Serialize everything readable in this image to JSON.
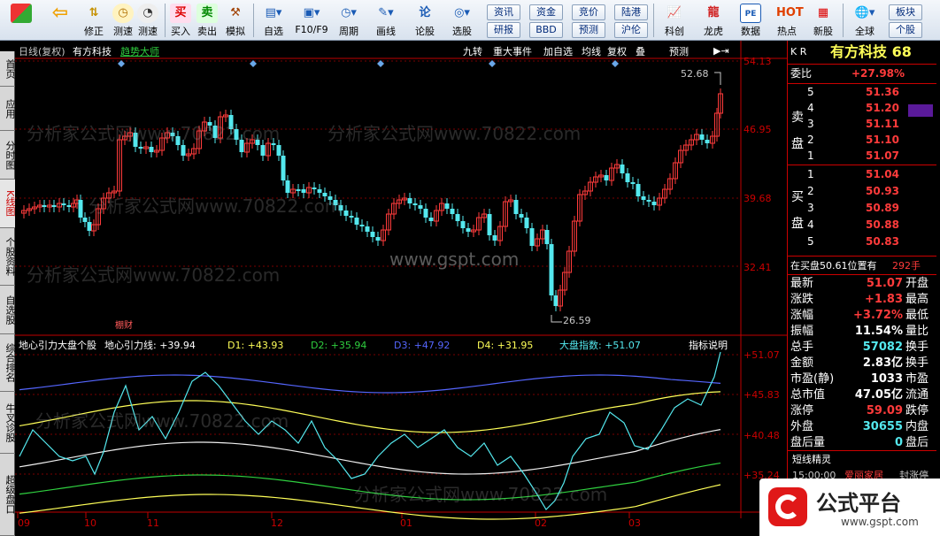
{
  "toolbar": {
    "buttons": [
      {
        "label": "",
        "icon": "app-grid-icon"
      },
      {
        "label": "",
        "icon": "back-arrow-icon"
      },
      {
        "label": "修正",
        "icon": "up-down-arrow-icon"
      },
      {
        "label": "测速",
        "icon": "speed-clock-icon"
      },
      {
        "label": "买入",
        "icon": "buy-icon"
      },
      {
        "label": "卖出",
        "icon": "sell-icon"
      },
      {
        "label": "模拟",
        "icon": "hammer-icon"
      },
      {
        "label": "自选",
        "icon": "watchlist-icon"
      },
      {
        "label": "F10/F9",
        "icon": "f10-icon"
      },
      {
        "label": "周期",
        "icon": "period-clock-icon"
      },
      {
        "label": "画线",
        "icon": "pencil-icon"
      },
      {
        "label": "论股",
        "icon": "forum-icon"
      },
      {
        "label": "选股",
        "icon": "stock-select-icon"
      },
      {
        "label": "科创",
        "icon": "star-market-icon"
      },
      {
        "label": "龙虎",
        "icon": "dragon-tiger-icon"
      },
      {
        "label": "数据",
        "icon": "pe-data-icon"
      },
      {
        "label": "热点",
        "icon": "hotspot-icon"
      },
      {
        "label": "新股",
        "icon": "ipo-icon"
      },
      {
        "label": "全球",
        "icon": "globe-icon"
      }
    ],
    "mini_buttons": [
      "资讯",
      "资金",
      "竞价",
      "陆港",
      "研报",
      "BBD",
      "预测",
      "沪伦",
      "板块",
      "个股"
    ]
  },
  "left_tabs": [
    "首页",
    "应用",
    "分时图",
    "K线图",
    "个股资料",
    "自选股",
    "综合排名",
    "牛叉诊股",
    "超级盘口"
  ],
  "chart_header": {
    "period": "日线(复权)",
    "stock_name": "有方科技",
    "indicator_name": "趋势大师",
    "buttons": [
      "九转",
      "重大事件",
      "加自选",
      "均线",
      "复权",
      "叠",
      "预测"
    ]
  },
  "price_axis": [
    "54.13",
    "46.95",
    "39.68",
    "32.41"
  ],
  "price_annotations": {
    "high": "52.68",
    "low": "26.59",
    "tag": "棚财"
  },
  "indicator_header": {
    "title": "地心引力大盘个股",
    "line": "地心引力线: +39.94",
    "d1": "D1: +43.93",
    "d2": "D2: +35.94",
    "d3": "D3: +47.92",
    "d4": "D4: +31.95",
    "index": "大盘指数: +51.07",
    "help": "指标说明"
  },
  "indicator_axis": [
    "+51.07",
    "+45.83",
    "+40.48",
    "+35.24"
  ],
  "date_axis": [
    "09",
    "10",
    "11",
    "12",
    "01",
    "02",
    "03"
  ],
  "watermarks": {
    "site1": "分析家公式网www.70822.com",
    "site2": "www.gspt.com"
  },
  "quote": {
    "market": "K R",
    "title": "有方科技 68",
    "weibi_label": "委比",
    "weibi_value": "+27.98%",
    "sell_label": "卖盘",
    "buy_label": "买盘",
    "sell_levels": [
      {
        "level": "5",
        "price": "51.36"
      },
      {
        "level": "4",
        "price": "51.20"
      },
      {
        "level": "3",
        "price": "51.11"
      },
      {
        "level": "2",
        "price": "51.10"
      },
      {
        "level": "1",
        "price": "51.07"
      }
    ],
    "buy_levels": [
      {
        "level": "1",
        "price": "51.04"
      },
      {
        "level": "2",
        "price": "50.93"
      },
      {
        "level": "3",
        "price": "50.89"
      },
      {
        "level": "4",
        "price": "50.88"
      },
      {
        "level": "5",
        "price": "50.83"
      }
    ],
    "position_text": "在买盘50.61位置有",
    "position_value": "292手",
    "fields": [
      {
        "label": "最新",
        "value": "51.07",
        "right": "开盘"
      },
      {
        "label": "涨跌",
        "value": "+1.83",
        "right": "最高"
      },
      {
        "label": "涨幅",
        "value": "+3.72%",
        "right": "最低"
      },
      {
        "label": "振幅",
        "value": "11.54%",
        "right": "量比"
      },
      {
        "label": "总手",
        "value": "57082",
        "right": "换手"
      },
      {
        "label": "金额",
        "value": "2.83亿",
        "right": "换手"
      },
      {
        "label": "市盈(静)",
        "value": "1033",
        "right": "市盈"
      },
      {
        "label": "总市值",
        "value": "47.05亿",
        "right": "流通"
      },
      {
        "label": "涨停",
        "value": "59.09",
        "right": "跌停"
      },
      {
        "label": "外盘",
        "value": "30655",
        "right": "内盘"
      },
      {
        "label": "盘后量",
        "value": "0",
        "right": "盘后"
      }
    ],
    "short_title": "短线精灵",
    "short_time": "15:00:00",
    "short_stock": "爱丽家居",
    "short_event": "封涨停"
  },
  "logo": {
    "text": "公式平台",
    "url": "www.gspt.com"
  },
  "colors": {
    "up": "#ff3b3b",
    "down": "#54e8ee",
    "axis": "#c00000",
    "yellow": "#ffff58",
    "blue": "#5566ff",
    "green": "#2fcf3f"
  }
}
